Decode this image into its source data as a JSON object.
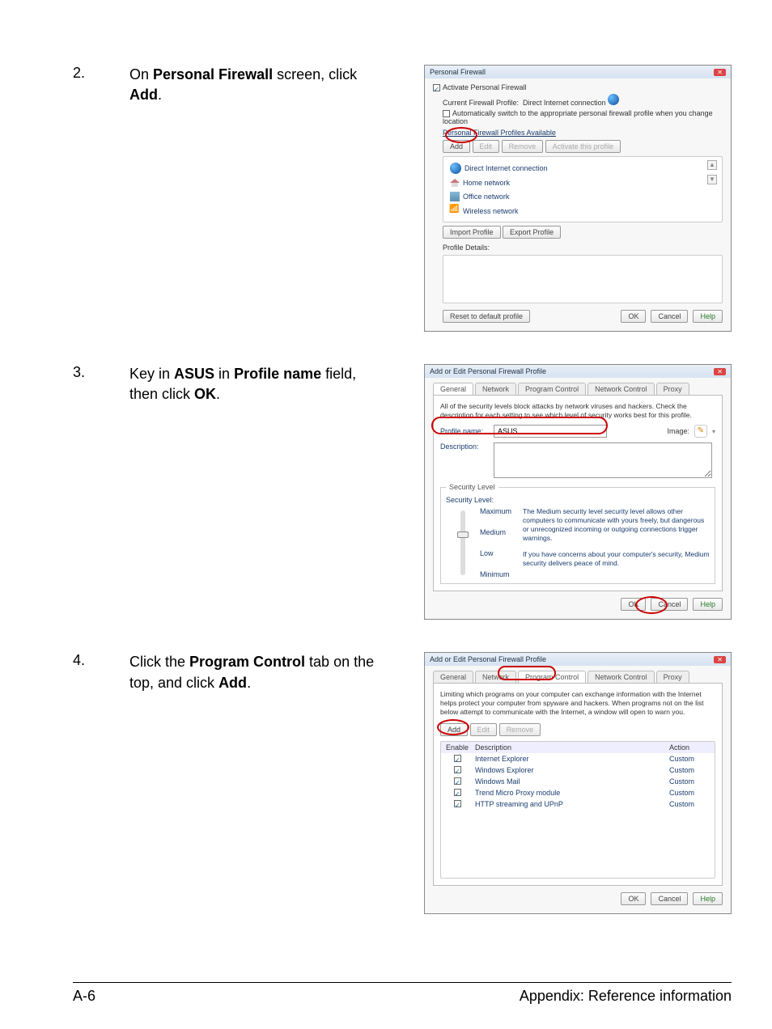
{
  "steps": [
    {
      "num": "2.",
      "text_parts": [
        "On ",
        "Personal Firewall",
        " screen, click ",
        "Add",
        "."
      ]
    },
    {
      "num": "3.",
      "text_parts": [
        "Key in ",
        "ASUS",
        " in ",
        "Profile name",
        " field, then click ",
        "OK",
        "."
      ]
    },
    {
      "num": "4.",
      "text_parts": [
        "Click the ",
        "Program Control",
        " tab on the top, and click ",
        "Add",
        "."
      ]
    }
  ],
  "shot1": {
    "title": "Personal Firewall",
    "activate_label": "Activate Personal Firewall",
    "current_profile_label": "Current Firewall Profile:",
    "current_profile_value": "Direct Internet connection",
    "auto_switch": "Automatically switch to the appropriate personal firewall profile when you change location",
    "profiles_avail": "Personal Firewall Profiles Available",
    "buttons": {
      "add": "Add",
      "edit": "Edit",
      "remove": "Remove",
      "activate": "Activate this profile"
    },
    "profiles": [
      "Direct Internet connection",
      "Home network",
      "Office network",
      "Wireless network"
    ],
    "import": "Import Profile",
    "export": "Export Profile",
    "details_label": "Profile Details:",
    "reset": "Reset to default profile",
    "ok": "OK",
    "cancel": "Cancel",
    "help": "Help"
  },
  "shot2": {
    "title": "Add or Edit Personal Firewall Profile",
    "tabs": [
      "General",
      "Network",
      "Program Control",
      "Network Control",
      "Proxy"
    ],
    "intro": "All of the security levels block attacks by network viruses and hackers. Check the description for each setting to see which level of security works best for this profile.",
    "profile_name_label": "Profile name:",
    "profile_name_value": "ASUS",
    "image_label": "Image:",
    "description_label": "Description:",
    "sec_group": "Security Level",
    "sec_level_label": "Security Level:",
    "levels": [
      "Maximum",
      "Medium",
      "Low",
      "Minimum"
    ],
    "level_text1": "The Medium security level security level allows other computers to communicate with yours freely, but dangerous or unrecognized incoming or outgoing connections trigger warnings.",
    "level_text2": "If you have concerns about your computer's security, Medium security delivers peace of mind.",
    "ok": "OK",
    "cancel": "Cancel",
    "help": "Help"
  },
  "shot3": {
    "title": "Add or Edit Personal Firewall Profile",
    "tabs": [
      "General",
      "Network",
      "Program Control",
      "Network Control",
      "Proxy"
    ],
    "intro": "Limiting which programs on your computer can exchange information with the Internet helps protect your computer from spyware and hackers. When programs not on the list below attempt to communicate with the Internet, a window will open to warn you.",
    "buttons": {
      "add": "Add",
      "edit": "Edit",
      "remove": "Remove"
    },
    "head_enable": "Enable",
    "head_desc": "Description",
    "head_action": "Action",
    "rows": [
      {
        "desc": "Internet Explorer",
        "action": "Custom"
      },
      {
        "desc": "Windows Explorer",
        "action": "Custom"
      },
      {
        "desc": "Windows Mail",
        "action": "Custom"
      },
      {
        "desc": "Trend Micro Proxy module",
        "action": "Custom"
      },
      {
        "desc": "HTTP streaming and UPnP",
        "action": "Custom"
      }
    ],
    "ok": "OK",
    "cancel": "Cancel",
    "help": "Help"
  },
  "footer": {
    "left": "A-6",
    "right": "Appendix: Reference information"
  }
}
